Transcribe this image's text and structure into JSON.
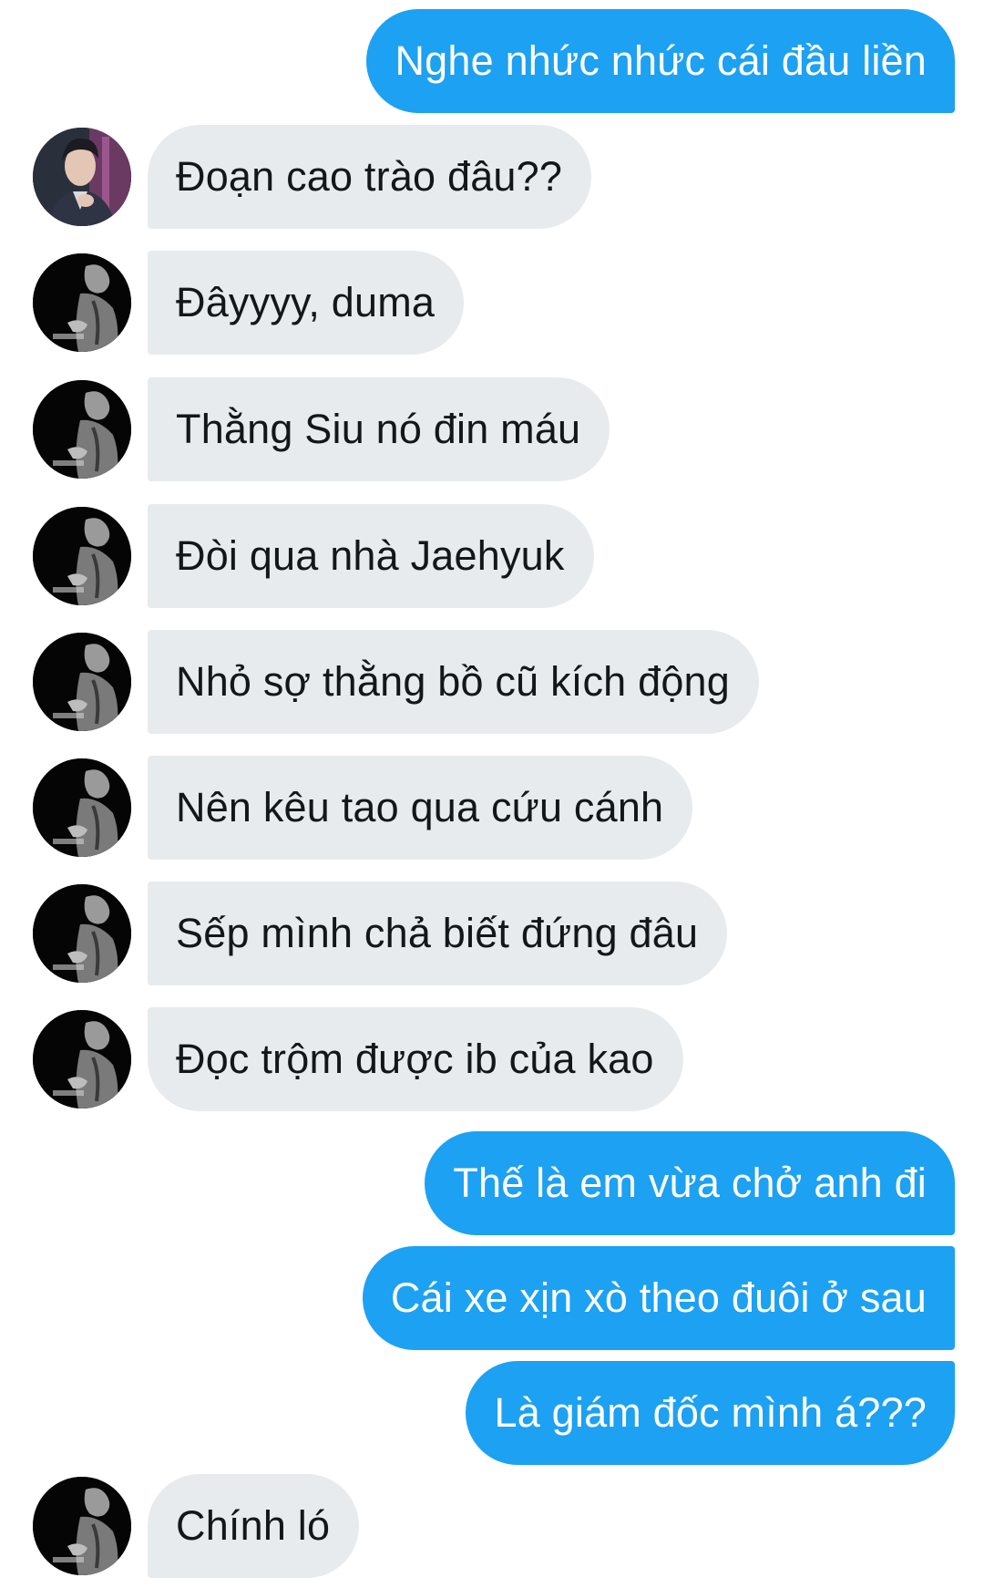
{
  "conversation": {
    "messages": [
      {
        "side": "out",
        "text": "Nghe nhức nhức cái đầu liền"
      },
      {
        "side": "in",
        "avatar": "avatar-photo-suit",
        "text": "Đoạn cao trào đâu??"
      },
      {
        "side": "in",
        "avatar": "avatar-photo-bw",
        "text": "Đâyyyy, duma"
      },
      {
        "side": "in",
        "avatar": "avatar-photo-bw",
        "text": "Thằng Siu nó đin máu"
      },
      {
        "side": "in",
        "avatar": "avatar-photo-bw",
        "text": "Đòi qua nhà Jaehyuk"
      },
      {
        "side": "in",
        "avatar": "avatar-photo-bw",
        "text": "Nhỏ sợ thằng bồ cũ kích động"
      },
      {
        "side": "in",
        "avatar": "avatar-photo-bw",
        "text": "Nên kêu tao qua cứu cánh"
      },
      {
        "side": "in",
        "avatar": "avatar-photo-bw",
        "text": "Sếp mình chả biết đứng đâu"
      },
      {
        "side": "in",
        "avatar": "avatar-photo-bw",
        "text": "Đọc trộm được ib của kao"
      },
      {
        "side": "out",
        "text": "Thế là em vừa chở anh đi"
      },
      {
        "side": "out",
        "text": "Cái xe xịn xò theo đuôi ở sau"
      },
      {
        "side": "out",
        "text": "Là giám đốc mình á???"
      },
      {
        "side": "in",
        "avatar": "avatar-photo-bw",
        "text": "Chính ló"
      }
    ]
  },
  "colors": {
    "outgoing_bubble": "#1da1f2",
    "outgoing_text": "#ffffff",
    "incoming_bubble": "#e7ebee",
    "incoming_text": "#14171a",
    "background": "#ffffff"
  }
}
